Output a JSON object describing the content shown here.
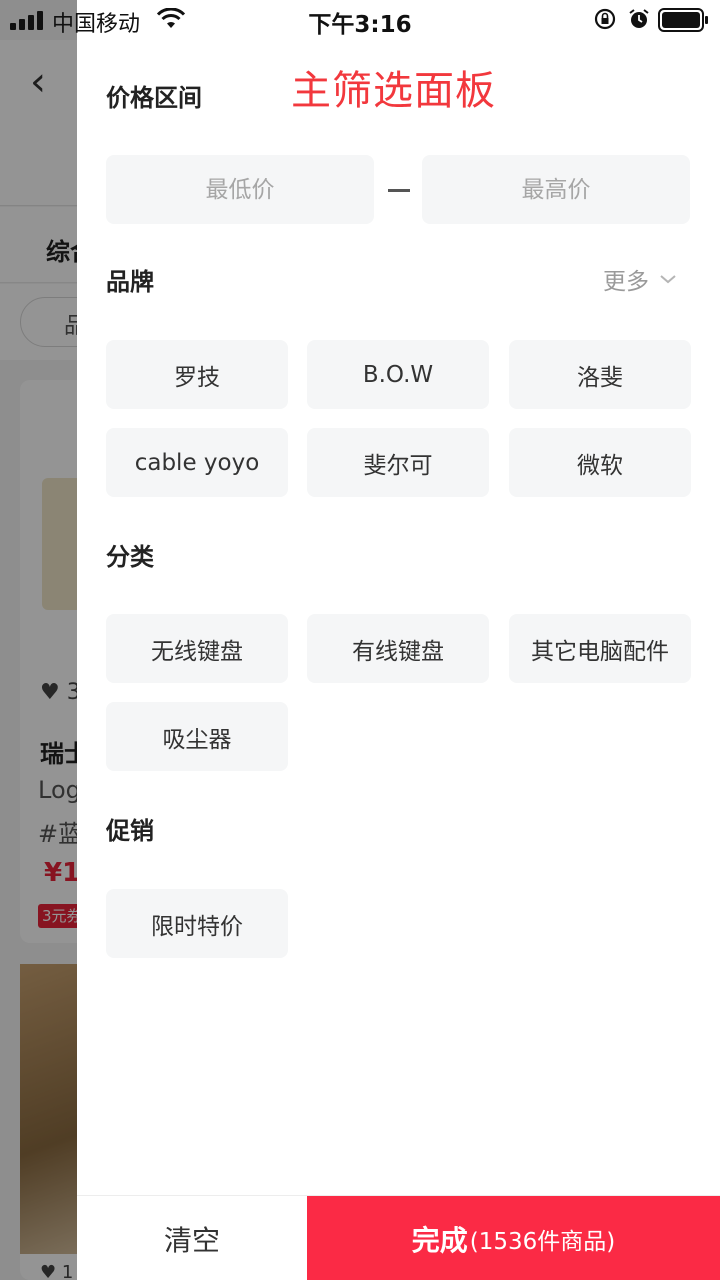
{
  "status_bar": {
    "carrier": "中国移动",
    "time": "下午3:16"
  },
  "background": {
    "sort_label": "综合",
    "chip_label": "品",
    "product_likes": "3",
    "product_title": "瑞士",
    "product_sub_1": "Log",
    "product_sub_2": "#蓝",
    "product_price": "¥1",
    "coupon": "3元券",
    "product2_likes": "1"
  },
  "annotation": "主筛选面板",
  "filter": {
    "price": {
      "title": "价格区间",
      "min_placeholder": "最低价",
      "max_placeholder": "最高价",
      "min_value": "",
      "max_value": ""
    },
    "brand": {
      "title": "品牌",
      "more_label": "更多",
      "options": [
        "罗技",
        "B.O.W",
        "洛斐",
        "cable yoyo",
        "斐尔可",
        "微软"
      ]
    },
    "category": {
      "title": "分类",
      "options": [
        "无线键盘",
        "有线键盘",
        "其它电脑配件",
        "吸尘器"
      ]
    },
    "promotion": {
      "title": "促销",
      "options": [
        "限时特价"
      ]
    }
  },
  "actions": {
    "clear_label": "清空",
    "done_label": "完成",
    "done_count": "(1536件商品)"
  },
  "colors": {
    "accent": "#fb2a45",
    "annotation": "#f2383d",
    "chip_bg": "#f5f6f7"
  }
}
